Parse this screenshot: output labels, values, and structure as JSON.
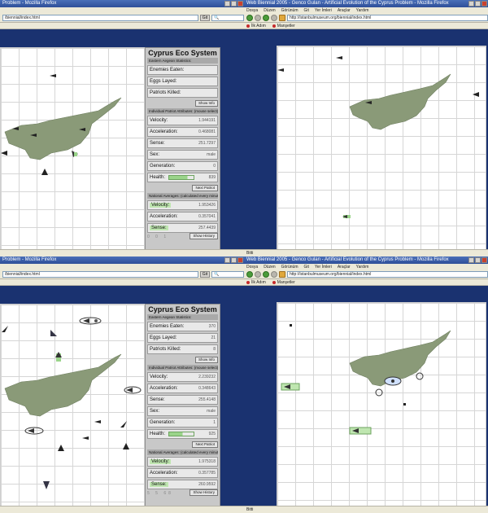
{
  "windows": {
    "left_title": "Web Biennial 2005 - Genco Gulan - Artificial Evolution of the Cyprus Problem - Mozilla Firefox",
    "right_title": "Web Biennial 2005 - Genco Gulan - Artificial Evolution of the Cyprus Problem - Mozilla Firefox",
    "left_title_short": "Problem - Mozilla Firefox",
    "url": "http://istanbulmuseum.org/biennial/index.html",
    "url_short": "/biennial/index.html",
    "search_placeholder": "",
    "go_label": "Git",
    "menu": [
      "Dosya",
      "Düzen",
      "Görünüm",
      "Git",
      "Yer İmleri",
      "Araçlar",
      "Yardım"
    ],
    "bookmarks": [
      "İlk Adım",
      "Manşetler"
    ],
    "status": "Bitti"
  },
  "panels": [
    {
      "title": "Cyprus Eco System",
      "stats_header": "Eastern Aegean Statistics:",
      "enemies_label": "Enemies Eaten:",
      "enemies_value": "",
      "eggs_label": "Eggs Layed:",
      "eggs_value": "",
      "patriots_label": "Patriots Killed:",
      "patriots_value": "",
      "show_info": "Show Info",
      "attr_header": "Individual Patriot Attributes: (mouse select)",
      "velocity_label": "Velocity:",
      "velocity_value": "1.944191",
      "accel_label": "Acceleration:",
      "accel_value": "0.468081",
      "sense_label": "Sense:",
      "sense_value": "251.7297",
      "sex_label": "Sex:",
      "sex_value": "male",
      "generation_label": "Generation:",
      "generation_value": "0",
      "health_label": "Health:",
      "health_value": "839",
      "health_fraction": 0.75,
      "next_patriot": "Next Patriot",
      "avg_header": "National Averages: (calculated every minute)",
      "avg_velocity_value": "1.953426",
      "avg_accel_value": "0.357041",
      "avg_sense_value": "257.4439",
      "show_history": "Show History",
      "dots": "0 0 1"
    },
    {
      "title": "Cyprus Eco System",
      "stats_header": "Eastern Aegean Statistics:",
      "enemies_label": "Enemies Eaten:",
      "enemies_value": "370",
      "eggs_label": "Eggs Layed:",
      "eggs_value": "21",
      "patriots_label": "Patriots Killed:",
      "patriots_value": "8",
      "show_info": "Show Info",
      "attr_header": "Individual Patriot Attributes: (mouse select)",
      "velocity_label": "Velocity:",
      "velocity_value": "2.239232",
      "accel_label": "Acceleration:",
      "accel_value": "0.348643",
      "sense_label": "Sense:",
      "sense_value": "255.4148",
      "sex_label": "Sex:",
      "sex_value": "male",
      "generation_label": "Generation:",
      "generation_value": "1",
      "health_label": "Health:",
      "health_value": "925",
      "health_fraction": 0.55,
      "next_patriot": "Next Patriot",
      "avg_header": "National Averages: (calculated every minute)",
      "avg_velocity_value": "1.975318",
      "avg_accel_value": "0.357785",
      "avg_sense_value": "260.9592",
      "show_history": "Show History",
      "dots": "5 5 68"
    }
  ],
  "colors": {
    "desktop": "#0d1f4a",
    "stage_bg": "#ffffff",
    "grid": "#d6d6d6",
    "island": "#8a9a78",
    "panel": "#c8c8c8",
    "highlight_green": "#bfe6b0"
  },
  "icons": [
    "back-arrow-icon",
    "forward-arrow-icon",
    "reload-icon",
    "stop-icon",
    "home-icon",
    "search-icon",
    "bookmark-icon",
    "critter-icon"
  ]
}
